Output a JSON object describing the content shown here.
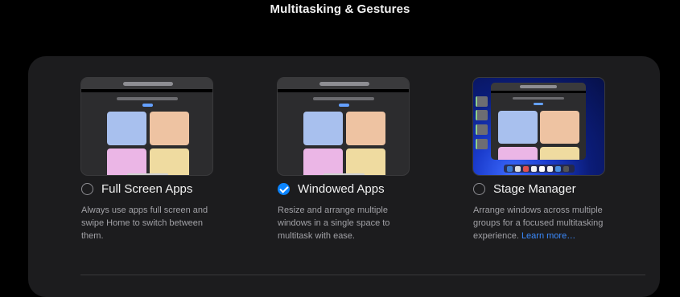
{
  "page": {
    "title": "Multitasking & Gestures"
  },
  "options": [
    {
      "label": "Full Screen Apps",
      "selected": false,
      "description": "Always use apps full screen and swipe Home to switch between them."
    },
    {
      "label": "Windowed Apps",
      "selected": true,
      "description": "Resize and arrange multiple windows in a single space to multitask with ease."
    },
    {
      "label": "Stage Manager",
      "selected": false,
      "description": "Arrange windows across multiple groups for a focused multitasking experience.",
      "link_text": "Learn more…"
    }
  ],
  "colors": {
    "accent": "#0a84ff",
    "link": "#3b8bff",
    "panel": "#1c1c1e",
    "background": "#000000"
  },
  "dock_colors": [
    "#3a7bd5",
    "#e0e0e0",
    "#e05050",
    "#f5f5f5",
    "#ffffff",
    "#f0f0f0",
    "#4a90e2",
    "#555555"
  ]
}
